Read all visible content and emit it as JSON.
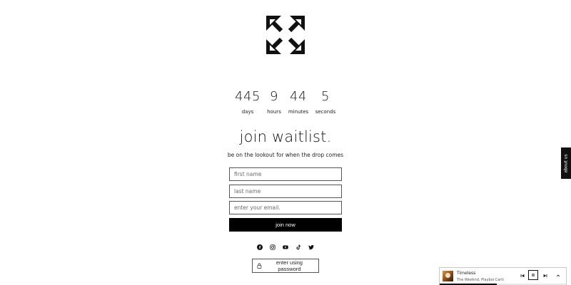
{
  "logo": {
    "icon": "arrows-expand-logo-icon"
  },
  "countdown": {
    "days": {
      "value": "445",
      "label": "days"
    },
    "hours": {
      "value": "9",
      "label": "hours"
    },
    "minutes": {
      "value": "44",
      "label": "minutes"
    },
    "seconds": {
      "value": "5",
      "label": "seconds"
    }
  },
  "waitlist": {
    "title": "join waitlist.",
    "subtitle": "be on the lookout for when the drop comes",
    "first_name_placeholder": "first name",
    "first_name_value": "",
    "last_name_placeholder": "last name",
    "last_name_value": "",
    "email_placeholder": "enter your email.",
    "email_value": "",
    "submit_label": "join now"
  },
  "socials": [
    {
      "name": "facebook",
      "icon": "facebook-icon"
    },
    {
      "name": "instagram",
      "icon": "instagram-icon"
    },
    {
      "name": "youtube",
      "icon": "youtube-icon"
    },
    {
      "name": "tiktok",
      "icon": "tiktok-icon"
    },
    {
      "name": "twitter",
      "icon": "twitter-icon"
    }
  ],
  "password_button": {
    "label": "enter using password",
    "icon": "lock-icon"
  },
  "about_tab": {
    "label": "about us"
  },
  "player": {
    "track": "Timeless",
    "artist": "The Weeknd, Playboi Carti",
    "progress": 0.45,
    "state": "playing",
    "icons": {
      "prev": "skip-previous-icon",
      "pause": "pause-icon",
      "next": "skip-next-icon",
      "expand": "chevron-up-icon"
    }
  },
  "colors": {
    "background": "#ffffff",
    "text": "#111111",
    "button": "#000000",
    "button_text": "#ffffff"
  }
}
